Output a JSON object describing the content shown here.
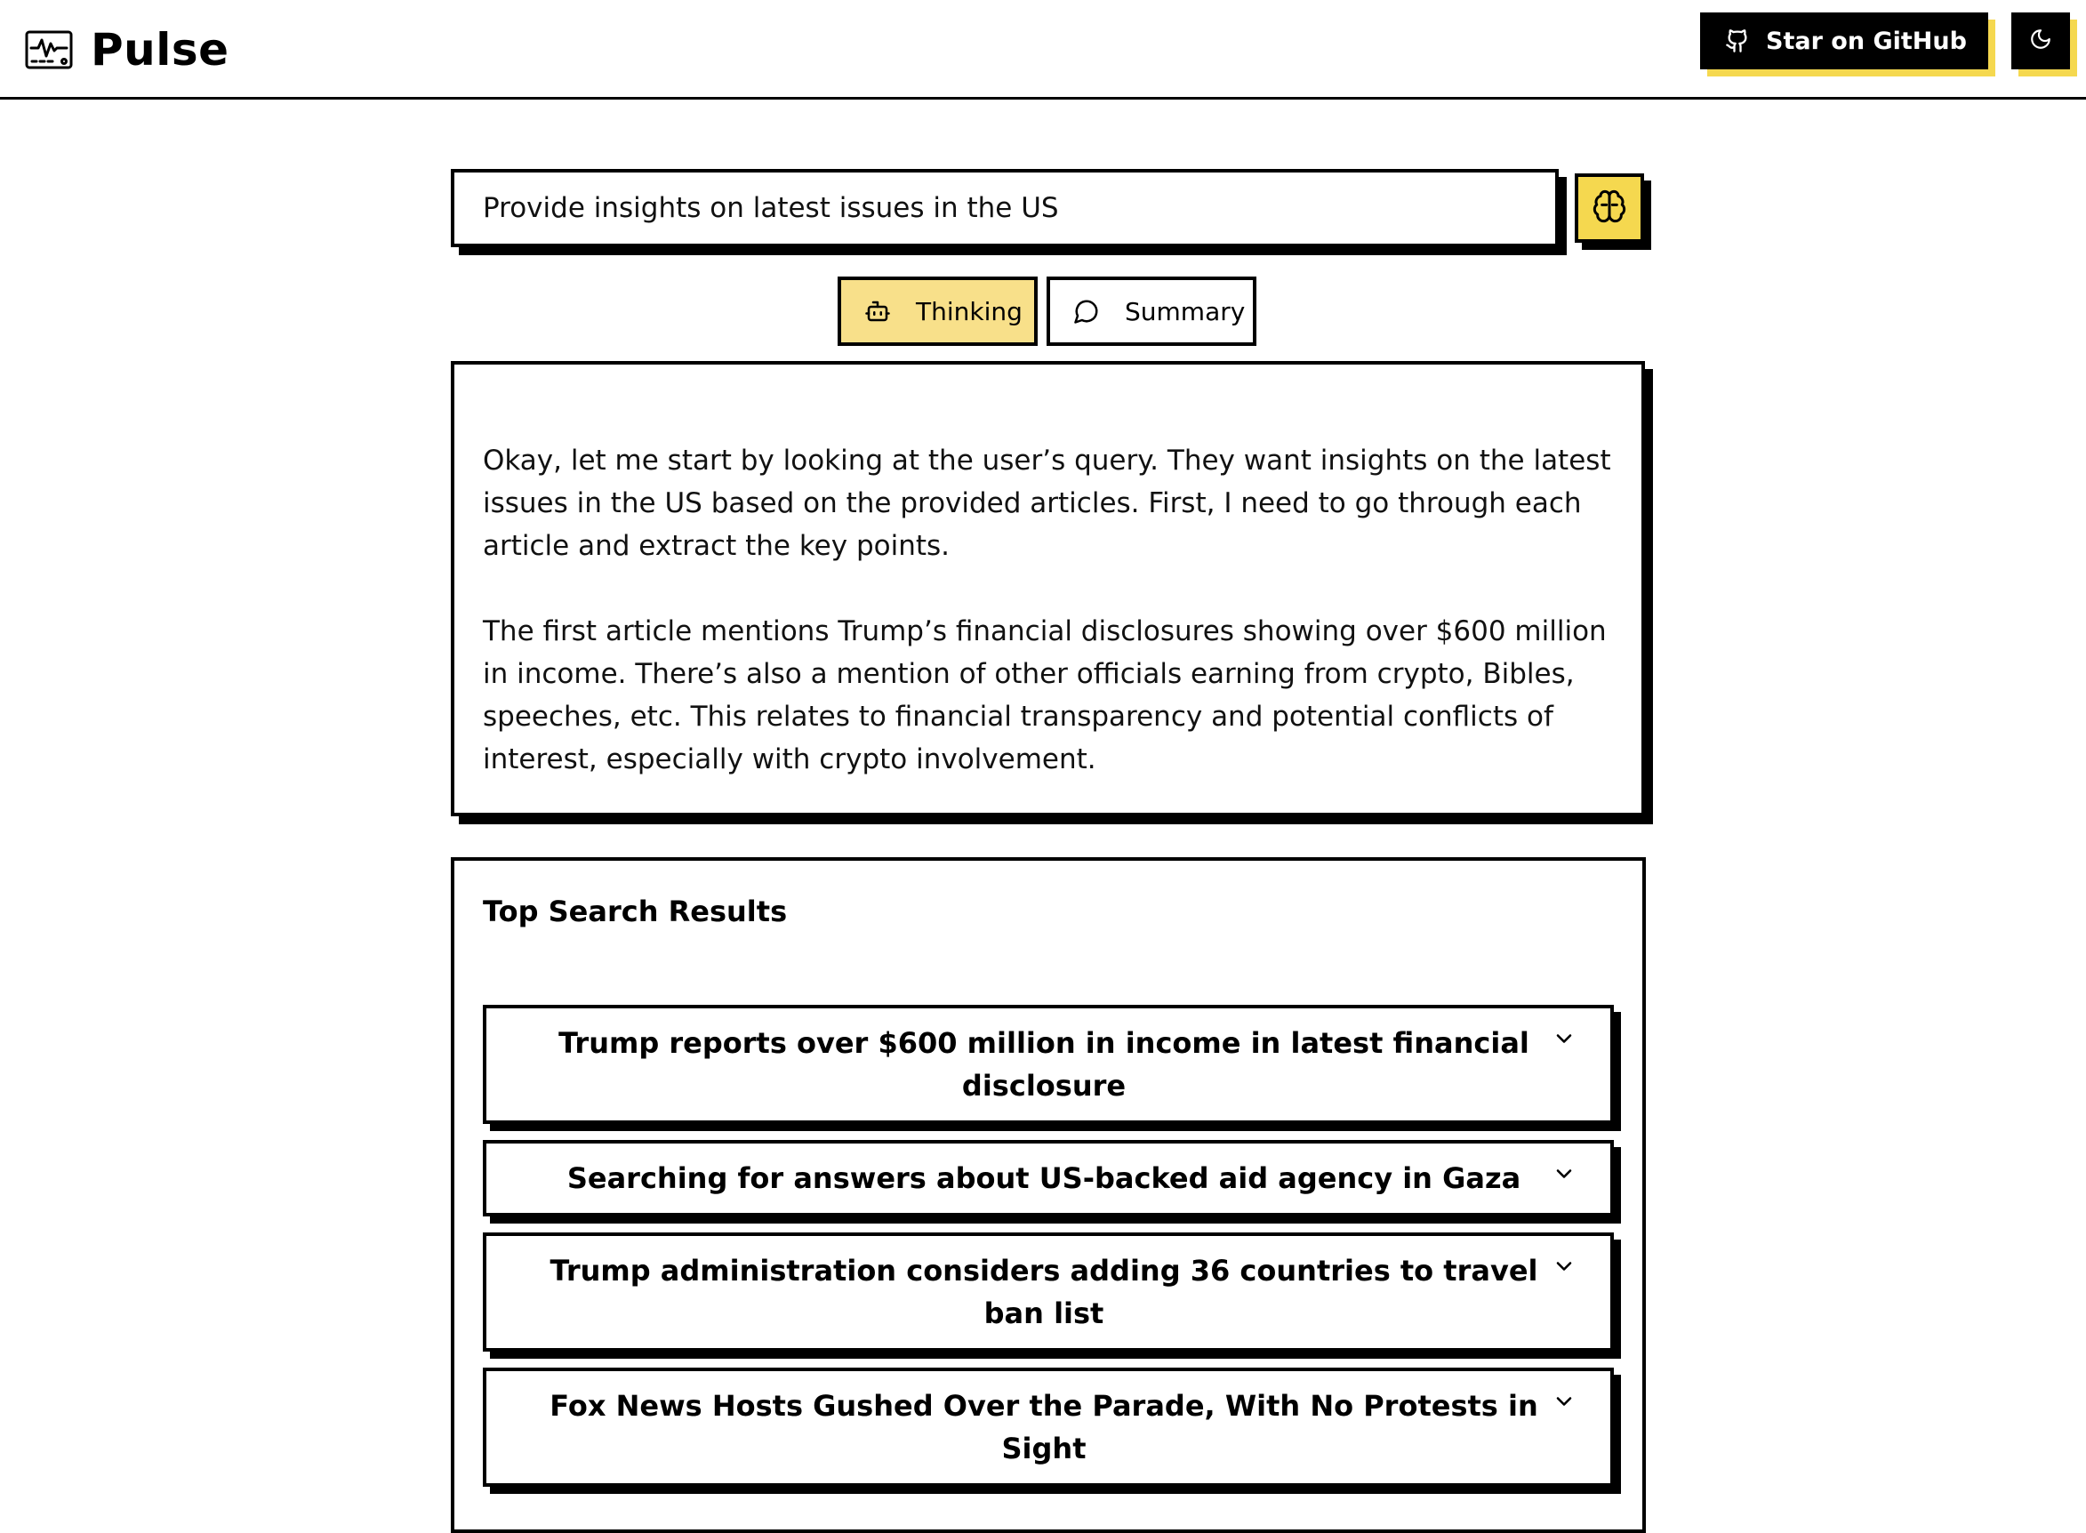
{
  "app": {
    "title": "Pulse",
    "logo_icon": "monitor-pulse-icon"
  },
  "header": {
    "github_button": {
      "label": "Star on GitHub",
      "icon": "github-icon"
    },
    "theme_toggle": {
      "icon": "moon-icon"
    }
  },
  "search": {
    "value": "Provide insights on latest issues in the US",
    "submit_icon": "brain-icon"
  },
  "tabs": [
    {
      "label": "Thinking",
      "icon": "bot-icon",
      "active": true
    },
    {
      "label": "Summary",
      "icon": "message-circle-icon",
      "active": false
    }
  ],
  "thinking": {
    "paragraphs": [
      "Okay, let me start by looking at the user’s query. They want insights on the latest issues in the US based on the provided articles. First, I need to go through each article and extract the key points.",
      "The first article mentions Trump’s financial disclosures showing over $600 million in income. There’s also a mention of other officials earning from crypto, Bibles, speeches, etc. This relates to financial transparency and potential conflicts of interest, especially with crypto involvement."
    ]
  },
  "results": {
    "title": "Top Search Results",
    "items": [
      {
        "title": "Trump reports over $600 million in income in latest financial disclosure"
      },
      {
        "title": "Searching for answers about US-backed aid agency in Gaza"
      },
      {
        "title": "Trump administration considers adding 36 countries to travel ban list"
      },
      {
        "title": "Fox News Hosts Gushed Over the Parade, With No Protests in Sight"
      }
    ]
  },
  "colors": {
    "accent_yellow": "#f5d84f",
    "tab_active_bg": "#f8e08a",
    "border": "#000000"
  }
}
